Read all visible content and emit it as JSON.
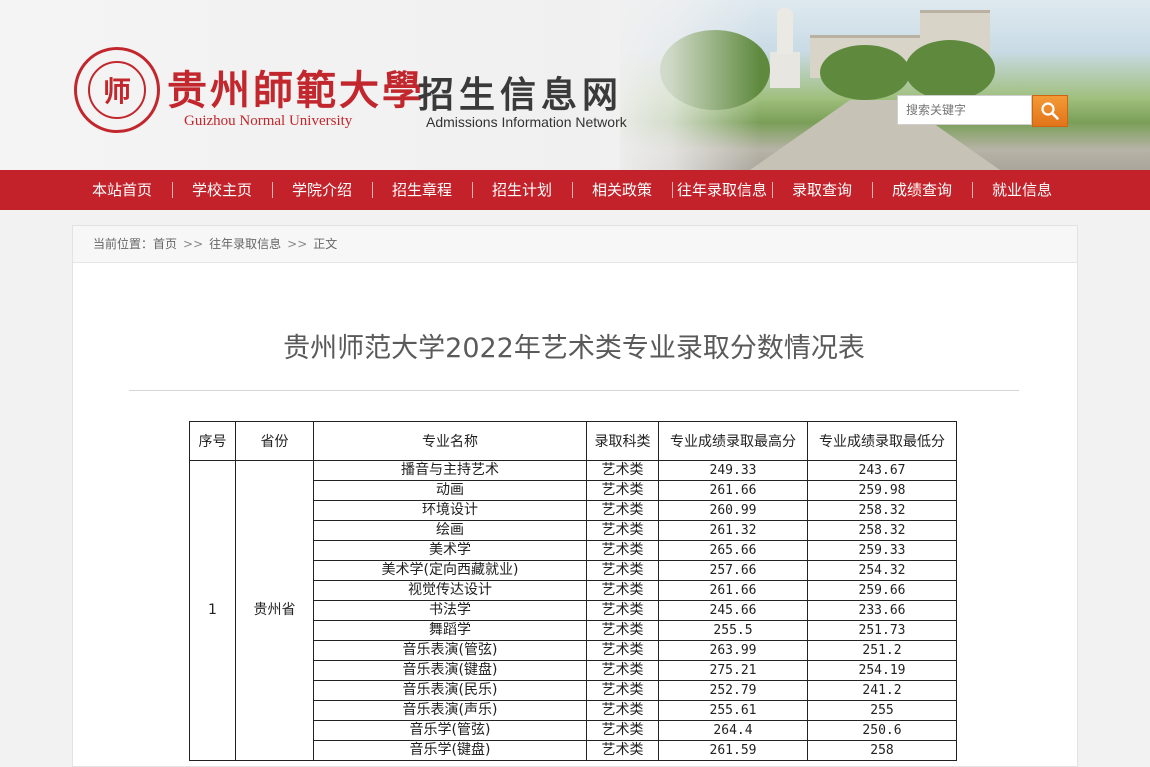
{
  "header": {
    "university_cn": "贵州師範大學",
    "university_en": "Guizhou Normal University",
    "seal_char": "师",
    "site_cn": "招生信息网",
    "site_en": "Admissions Information Network",
    "search_placeholder": "搜索关键字"
  },
  "nav": {
    "items": [
      "本站首页",
      "学校主页",
      "学院介绍",
      "招生章程",
      "招生计划",
      "相关政策",
      "往年录取信息",
      "录取查询",
      "成绩查询",
      "就业信息"
    ]
  },
  "breadcrumb": {
    "prefix": "当前位置：",
    "items": [
      "首页",
      "往年录取信息",
      "正文"
    ],
    "separator": ">>"
  },
  "article": {
    "title": "贵州师范大学2022年艺术类专业录取分数情况表"
  },
  "table": {
    "headers": [
      "序号",
      "省份",
      "专业名称",
      "录取科类",
      "专业成绩录取最高分",
      "专业成绩录取最低分"
    ],
    "group": {
      "seq": "1",
      "province": "贵州省"
    },
    "rows": [
      {
        "major": "播音与主持艺术",
        "category": "艺术类",
        "max": "249.33",
        "min": "243.67"
      },
      {
        "major": "动画",
        "category": "艺术类",
        "max": "261.66",
        "min": "259.98"
      },
      {
        "major": "环境设计",
        "category": "艺术类",
        "max": "260.99",
        "min": "258.32"
      },
      {
        "major": "绘画",
        "category": "艺术类",
        "max": "261.32",
        "min": "258.32"
      },
      {
        "major": "美术学",
        "category": "艺术类",
        "max": "265.66",
        "min": "259.33"
      },
      {
        "major": "美术学(定向西藏就业)",
        "category": "艺术类",
        "max": "257.66",
        "min": "254.32"
      },
      {
        "major": "视觉传达设计",
        "category": "艺术类",
        "max": "261.66",
        "min": "259.66"
      },
      {
        "major": "书法学",
        "category": "艺术类",
        "max": "245.66",
        "min": "233.66"
      },
      {
        "major": "舞蹈学",
        "category": "艺术类",
        "max": "255.5",
        "min": "251.73"
      },
      {
        "major": "音乐表演(管弦)",
        "category": "艺术类",
        "max": "263.99",
        "min": "251.2"
      },
      {
        "major": "音乐表演(键盘)",
        "category": "艺术类",
        "max": "275.21",
        "min": "254.19"
      },
      {
        "major": "音乐表演(民乐)",
        "category": "艺术类",
        "max": "252.79",
        "min": "241.2"
      },
      {
        "major": "音乐表演(声乐)",
        "category": "艺术类",
        "max": "255.61",
        "min": "255"
      },
      {
        "major": "音乐学(管弦)",
        "category": "艺术类",
        "max": "264.4",
        "min": "250.6"
      },
      {
        "major": "音乐学(键盘)",
        "category": "艺术类",
        "max": "261.59",
        "min": "258"
      }
    ]
  },
  "colors": {
    "brand_red": "#c4222a",
    "search_orange": "#e2741a"
  }
}
